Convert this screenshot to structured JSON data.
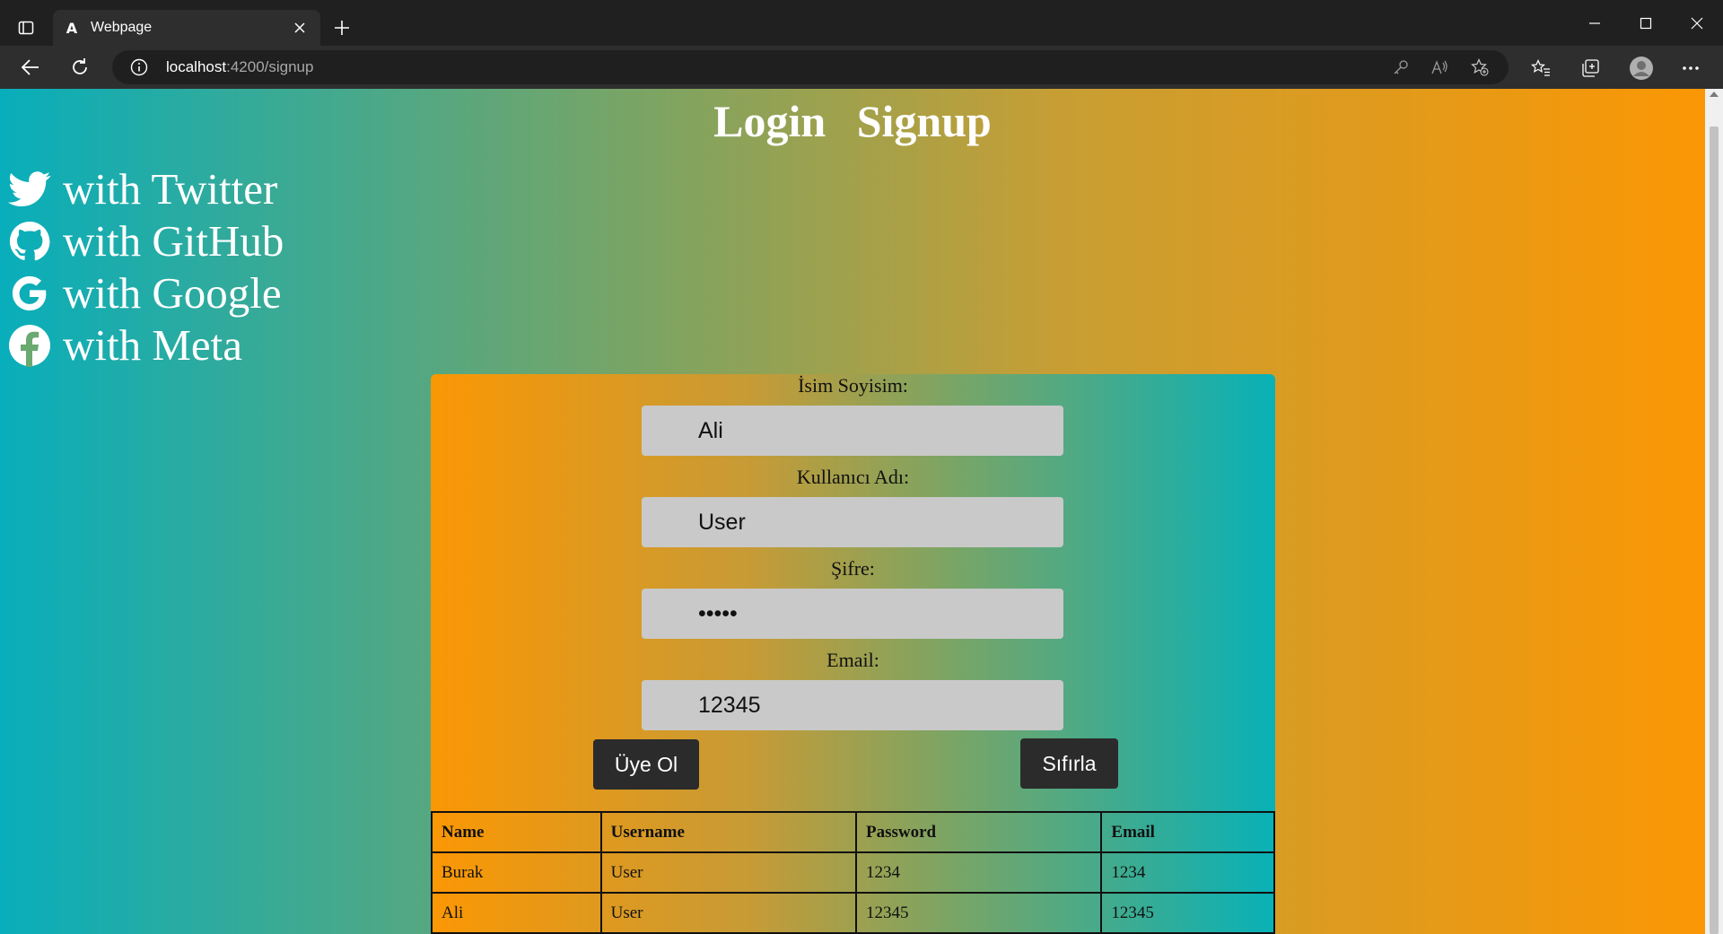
{
  "browser": {
    "tab_title": "Webpage",
    "tab_favicon": "A",
    "url_host": "localhost",
    "url_rest": ":4200/signup"
  },
  "nav": {
    "login": "Login",
    "signup": "Signup"
  },
  "social": [
    {
      "label": "with Twitter",
      "icon": "twitter-icon"
    },
    {
      "label": "with GitHub",
      "icon": "github-icon"
    },
    {
      "label": "with Google",
      "icon": "google-icon"
    },
    {
      "label": "with Meta",
      "icon": "facebook-icon"
    }
  ],
  "form": {
    "fullname_label": "İsim Soyisim:",
    "fullname_value": "Ali",
    "username_label": "Kullanıcı Adı:",
    "username_value": "User",
    "password_label": "Şifre:",
    "password_value": "12345",
    "email_label": "Email:",
    "email_value": "12345",
    "submit_label": "Üye Ol",
    "reset_label": "Sıfırla"
  },
  "table": {
    "headers": [
      "Name",
      "Username",
      "Password",
      "Email"
    ],
    "rows": [
      [
        "Burak",
        "User",
        "1234",
        "1234"
      ],
      [
        "Ali",
        "User",
        "12345",
        "12345"
      ]
    ]
  },
  "colors": {
    "page_gradient": [
      "#08aebb",
      "#fb9704"
    ],
    "panel_gradient": [
      "#fb9704",
      "#08b1b7"
    ],
    "button": "#2b2b2b",
    "input": "#c9c9c9"
  }
}
